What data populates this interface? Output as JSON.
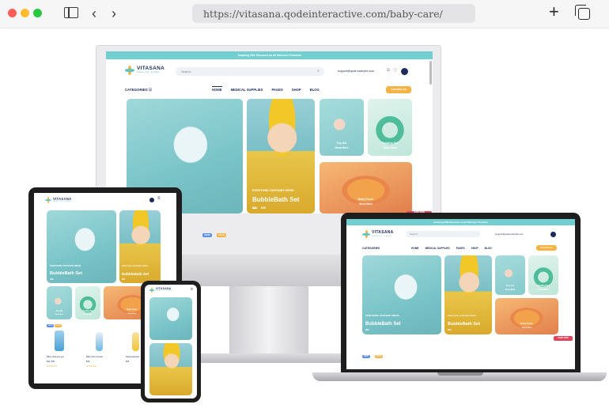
{
  "browser": {
    "url": "https://vitasana.qodeinteractive.com/baby-care/"
  },
  "site": {
    "announcement": "Amazing 20% Discount on all Skincare Products",
    "logo_name": "VITASANA",
    "logo_tagline": "HEALTH CARE",
    "search_placeholder": "Search",
    "email": "support@qode.example.com",
    "categories_label": "CATEGORIES",
    "nav": [
      "HOME",
      "MEDICAL SUPPLIES",
      "PAGES",
      "SHOP",
      "BLOG"
    ],
    "contact_label": "Contact us",
    "tiles": {
      "main_kicker": "EVERYTHING YOUR BABY NEEDS",
      "main_title": "BubbleBath Set",
      "main_title_partial": "t",
      "main_price_old": "$50",
      "main_price_new": "$35",
      "baby_kicker": "EVERYTHING YOUR BABY NEEDS",
      "baby_title": "BubbleBath Set",
      "baby_price_old": "$50",
      "baby_price_new": "$35",
      "toy_title": "Toy Set",
      "toy_link": "Show More",
      "feeding_title": "Feeding Set",
      "feeding_link": "Show More",
      "puree_title": "Baby Puree",
      "puree_link": "Show More"
    },
    "sale_badge": "SALE",
    "new_badge": "NEW",
    "shop_label": "SHOP NOW"
  },
  "tablet_products": [
    {
      "name": "Baby shampoo gel",
      "price": "$40  $35"
    },
    {
      "name": "Baby thermometer",
      "price": "$30"
    },
    {
      "name": "Nasal aspirator",
      "price": "$25"
    }
  ],
  "colors": {
    "teal": "#72cfd0",
    "navy": "#1d2a5c",
    "orange": "#f7b244"
  }
}
